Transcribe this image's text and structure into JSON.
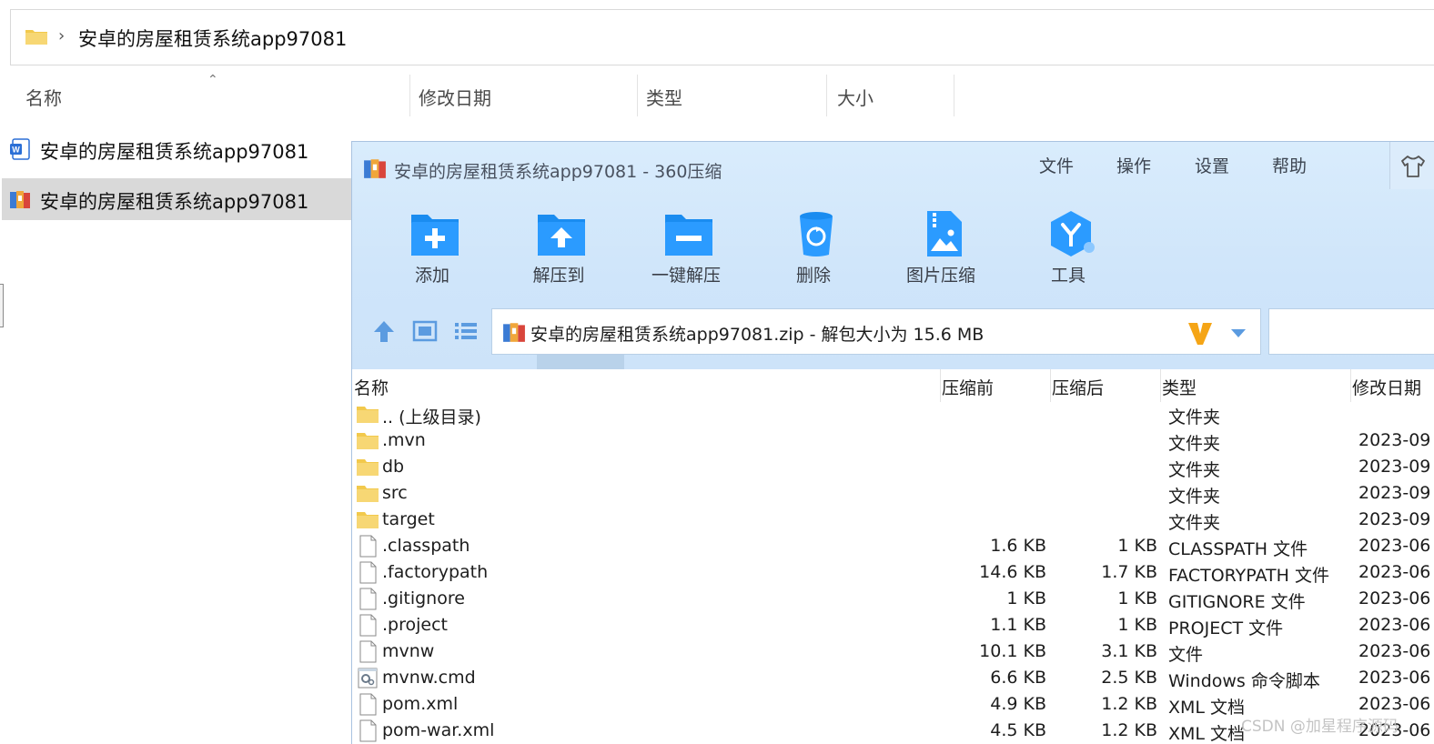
{
  "explorer": {
    "address_path": "安卓的房屋租赁系统app97081",
    "columns": {
      "name": "名称",
      "modified": "修改日期",
      "type": "类型",
      "size": "大小"
    },
    "files": [
      {
        "label": "安卓的房屋租赁系统app97081",
        "icon": "word-document-icon",
        "selected": false
      },
      {
        "label": "安卓的房屋租赁系统app97081",
        "icon": "zip-archive-icon",
        "selected": true
      }
    ]
  },
  "zip_window": {
    "title": "安卓的房屋租赁系统app97081 - 360压缩",
    "menu": [
      "文件",
      "操作",
      "设置",
      "帮助"
    ],
    "toolbar": [
      {
        "label": "添加",
        "icon": "add-folder-icon"
      },
      {
        "label": "解压到",
        "icon": "extract-to-icon"
      },
      {
        "label": "一键解压",
        "icon": "one-click-extract-icon"
      },
      {
        "label": "删除",
        "icon": "recycle-bin-icon"
      },
      {
        "label": "图片压缩",
        "icon": "image-compress-icon"
      },
      {
        "label": "工具",
        "icon": "tools-icon"
      }
    ],
    "path_text": "安卓的房屋租赁系统app97081.zip - 解包大小为 15.6 MB",
    "columns": {
      "name": "名称",
      "before": "压缩前",
      "after": "压缩后",
      "type": "类型",
      "modified": "修改日期"
    },
    "files": [
      {
        "name": ".. (上级目录)",
        "before": "",
        "after": "",
        "type": "文件夹",
        "modified": "",
        "kind": "folder"
      },
      {
        "name": ".mvn",
        "before": "",
        "after": "",
        "type": "文件夹",
        "modified": "2023-09",
        "kind": "folder"
      },
      {
        "name": "db",
        "before": "",
        "after": "",
        "type": "文件夹",
        "modified": "2023-09",
        "kind": "folder"
      },
      {
        "name": "src",
        "before": "",
        "after": "",
        "type": "文件夹",
        "modified": "2023-09",
        "kind": "folder"
      },
      {
        "name": "target",
        "before": "",
        "after": "",
        "type": "文件夹",
        "modified": "2023-09",
        "kind": "folder"
      },
      {
        "name": ".classpath",
        "before": "1.6 KB",
        "after": "1 KB",
        "type": "CLASSPATH 文件",
        "modified": "2023-06",
        "kind": "file"
      },
      {
        "name": ".factorypath",
        "before": "14.6 KB",
        "after": "1.7 KB",
        "type": "FACTORYPATH 文件",
        "modified": "2023-06",
        "kind": "file"
      },
      {
        "name": ".gitignore",
        "before": "1 KB",
        "after": "1 KB",
        "type": "GITIGNORE 文件",
        "modified": "2023-06",
        "kind": "file"
      },
      {
        "name": ".project",
        "before": "1.1 KB",
        "after": "1 KB",
        "type": "PROJECT 文件",
        "modified": "2023-06",
        "kind": "file"
      },
      {
        "name": "mvnw",
        "before": "10.1 KB",
        "after": "3.1 KB",
        "type": "文件",
        "modified": "2023-06",
        "kind": "file"
      },
      {
        "name": "mvnw.cmd",
        "before": "6.6 KB",
        "after": "2.5 KB",
        "type": "Windows 命令脚本",
        "modified": "2023-06",
        "kind": "script"
      },
      {
        "name": "pom.xml",
        "before": "4.9 KB",
        "after": "1.2 KB",
        "type": "XML 文档",
        "modified": "2023-06",
        "kind": "file"
      },
      {
        "name": "pom-war.xml",
        "before": "4.5 KB",
        "after": "1.2 KB",
        "type": "XML 文档",
        "modified": "2023-06",
        "kind": "file"
      }
    ]
  },
  "watermark": "CSDN @加星程序源码"
}
